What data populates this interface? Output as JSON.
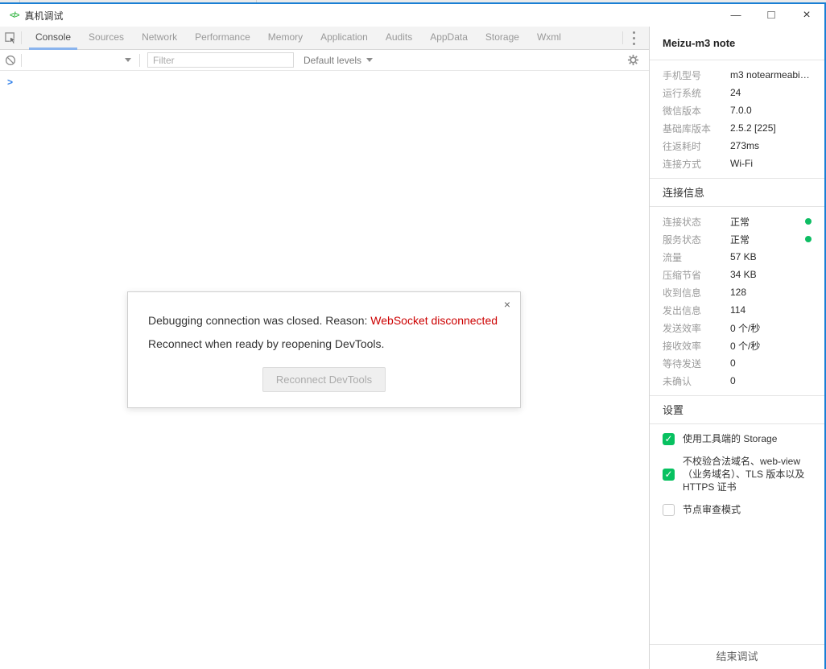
{
  "window": {
    "title": "真机调试",
    "controls": {
      "minimize": "—",
      "maximize": "□",
      "close": "×"
    }
  },
  "icons": {
    "app_glyph": "</>"
  },
  "tabs": {
    "items": [
      "Console",
      "Sources",
      "Network",
      "Performance",
      "Memory",
      "Application",
      "Audits",
      "AppData",
      "Storage",
      "Wxml"
    ]
  },
  "toolbar": {
    "filter_placeholder": "Filter",
    "levels_label": "Default levels"
  },
  "console": {
    "prompt": ">"
  },
  "dialog": {
    "close_glyph": "×",
    "message_prefix": "Debugging connection was closed. Reason: ",
    "message_reason": "WebSocket disconnected",
    "message_line2": "Reconnect when ready by reopening DevTools.",
    "button_label": "Reconnect DevTools"
  },
  "sidebar": {
    "device_title": "Meizu-m3 note",
    "device_info": [
      {
        "label": "手机型号",
        "value": "m3 notearmeabi…"
      },
      {
        "label": "运行系统",
        "value": "24"
      },
      {
        "label": "微信版本",
        "value": "7.0.0"
      },
      {
        "label": "基础库版本",
        "value": "2.5.2 [225]"
      },
      {
        "label": "往返耗时",
        "value": "273ms"
      },
      {
        "label": "连接方式",
        "value": "Wi-Fi"
      }
    ],
    "connection": {
      "title": "连接信息",
      "rows": [
        {
          "label": "连接状态",
          "value": "正常",
          "dot": true
        },
        {
          "label": "服务状态",
          "value": "正常",
          "dot": true
        },
        {
          "label": "流量",
          "value": "57 KB",
          "dot": false
        },
        {
          "label": "压缩节省",
          "value": "34 KB",
          "dot": false
        },
        {
          "label": "收到信息",
          "value": "128",
          "dot": false
        },
        {
          "label": "发出信息",
          "value": "114",
          "dot": false
        },
        {
          "label": "发送效率",
          "value": "0 个/秒",
          "dot": false
        },
        {
          "label": "接收效率",
          "value": "0 个/秒",
          "dot": false
        },
        {
          "label": "等待发送",
          "value": "0",
          "dot": false
        },
        {
          "label": "未确认",
          "value": "0",
          "dot": false
        }
      ]
    },
    "settings": {
      "title": "设置",
      "items": [
        {
          "label": "使用工具端的 Storage",
          "checked": true
        },
        {
          "label": "不校验合法域名、web-view（业务域名）、TLS 版本以及 HTTPS 证书",
          "checked": true
        },
        {
          "label": "节点审查模式",
          "checked": false
        }
      ]
    },
    "end_label": "结束调试"
  },
  "colors": {
    "accent_blue": "#1a7fd4",
    "tab_underline": "#8ab4ee",
    "status_green": "#0dbd63",
    "checkbox_green": "#07c160",
    "error_red": "#cc0000",
    "prompt_blue": "#2b7de9"
  }
}
